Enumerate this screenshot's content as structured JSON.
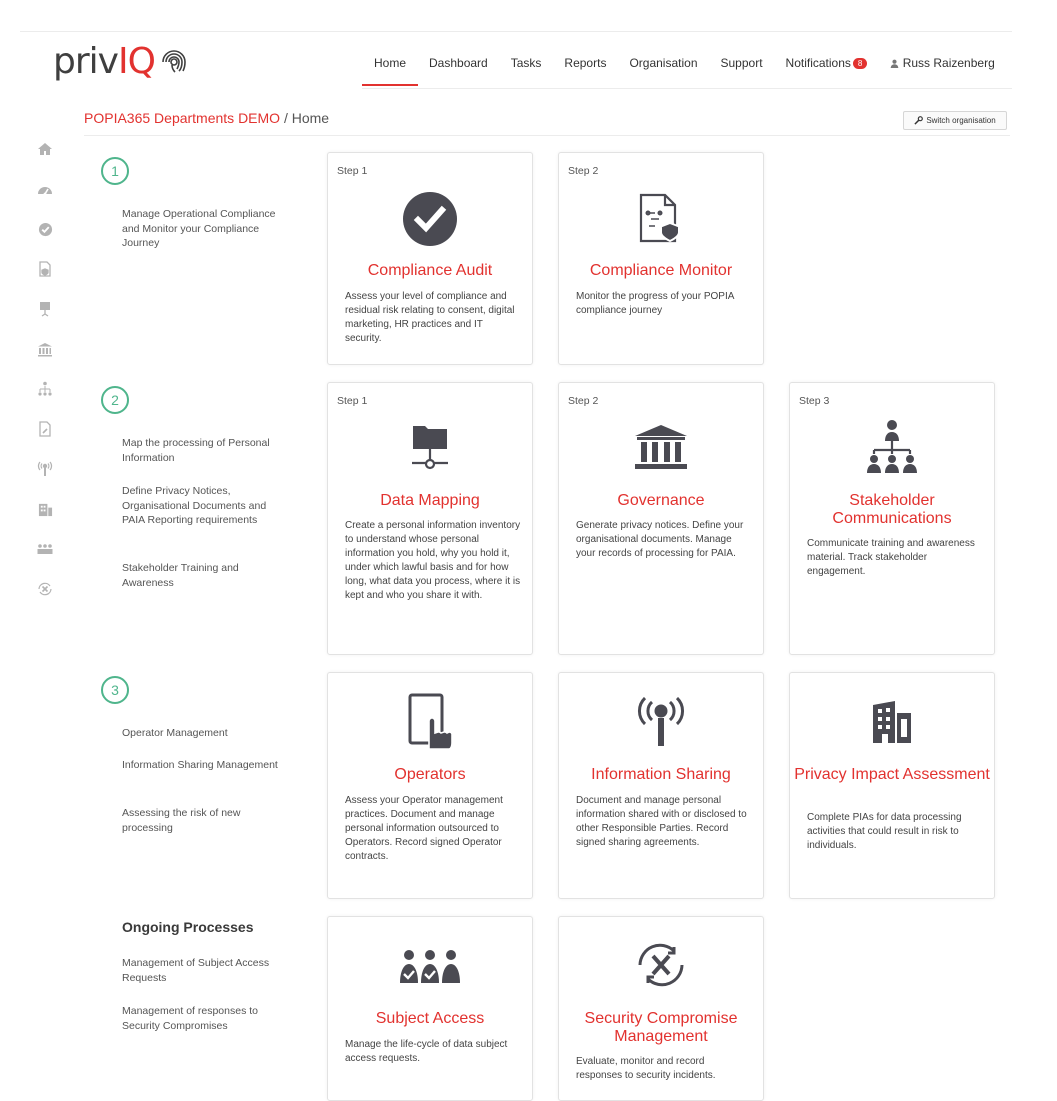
{
  "brand": {
    "name_part1": "priv",
    "name_part2": "IQ",
    "accent": "#e2322f",
    "green": "#4fb58c"
  },
  "nav": {
    "items": [
      "Home",
      "Dashboard",
      "Tasks",
      "Reports",
      "Organisation",
      "Support"
    ],
    "notifications_label": "Notifications",
    "notifications_count": "8",
    "user_name": "Russ Raizenberg"
  },
  "breadcrumb": {
    "org": "POPIA365 Departments DEMO",
    "separator": " / ",
    "page": "Home"
  },
  "switch_org_label": "Switch organisation",
  "sidebar_icons": [
    "home-icon",
    "dashboard-icon",
    "check-circle-icon",
    "document-shield-icon",
    "presentation-icon",
    "bank-icon",
    "sitemap-icon",
    "document-edit-icon",
    "broadcast-icon",
    "building-icon",
    "users-icon",
    "compromise-icon"
  ],
  "sections": {
    "s1": {
      "number": "1",
      "lines": [
        "Manage Operational Compliance and Monitor your Compliance Journey"
      ]
    },
    "s2": {
      "number": "2",
      "lines": [
        "Map the processing of Personal Information",
        "Define Privacy Notices, Organisational Documents and PAIA Reporting requirements",
        "Stakeholder Training and Awareness"
      ]
    },
    "s3": {
      "number": "3",
      "lines": [
        "Operator Management",
        "Information Sharing Management",
        "Assessing the risk of new processing"
      ]
    },
    "ongoing": {
      "heading": "Ongoing Processes",
      "lines": [
        "Management of Subject Access Requests",
        "Management of responses to Security Compromises"
      ]
    }
  },
  "cards": {
    "compliance_audit": {
      "step": "Step 1",
      "title": "Compliance Audit",
      "desc": "Assess your level of compliance and residual risk relating to consent, digital marketing, HR practices and IT security.",
      "icon": "check-circle-icon"
    },
    "compliance_monitor": {
      "step": "Step 2",
      "title": "Compliance Monitor",
      "desc": "Monitor the progress of your POPIA compliance journey",
      "icon": "document-shield-icon"
    },
    "data_mapping": {
      "step": "Step 1",
      "title": "Data Mapping",
      "desc": "Create a personal information inventory to understand whose personal information you hold, why you hold it, under which lawful basis and for how long, what data you process, where it is kept and who you share it with.",
      "icon": "folder-network-icon"
    },
    "governance": {
      "step": "Step 2",
      "title": "Governance",
      "desc": "Generate privacy notices. Define your organisational documents. Manage your records of processing for PAIA.",
      "icon": "bank-icon"
    },
    "stakeholder": {
      "step": "Step 3",
      "title": "Stakeholder Communications",
      "desc": "Communicate training and awareness material. Track stakeholder engagement.",
      "icon": "sitemap-icon"
    },
    "operators": {
      "title": "Operators",
      "desc": "Assess your Operator management practices. Document and manage personal information outsourced to Operators. Record signed Operator contracts.",
      "icon": "tablet-touch-icon"
    },
    "info_sharing": {
      "title": "Information Sharing",
      "desc": "Document and manage personal information shared with or disclosed to other Responsible Parties. Record signed sharing agreements.",
      "icon": "broadcast-icon"
    },
    "pia": {
      "title": "Privacy Impact Assessment",
      "desc": "Complete PIAs for data processing activities that could result in risk to individuals.",
      "icon": "building-icon"
    },
    "subject_access": {
      "title": "Subject Access",
      "desc": "Manage the life-cycle of data subject access requests.",
      "icon": "users-check-icon"
    },
    "security_compromise": {
      "title": "Security Compromise Management",
      "desc": "Evaluate, monitor and record responses to security incidents.",
      "icon": "compromise-icon"
    }
  }
}
